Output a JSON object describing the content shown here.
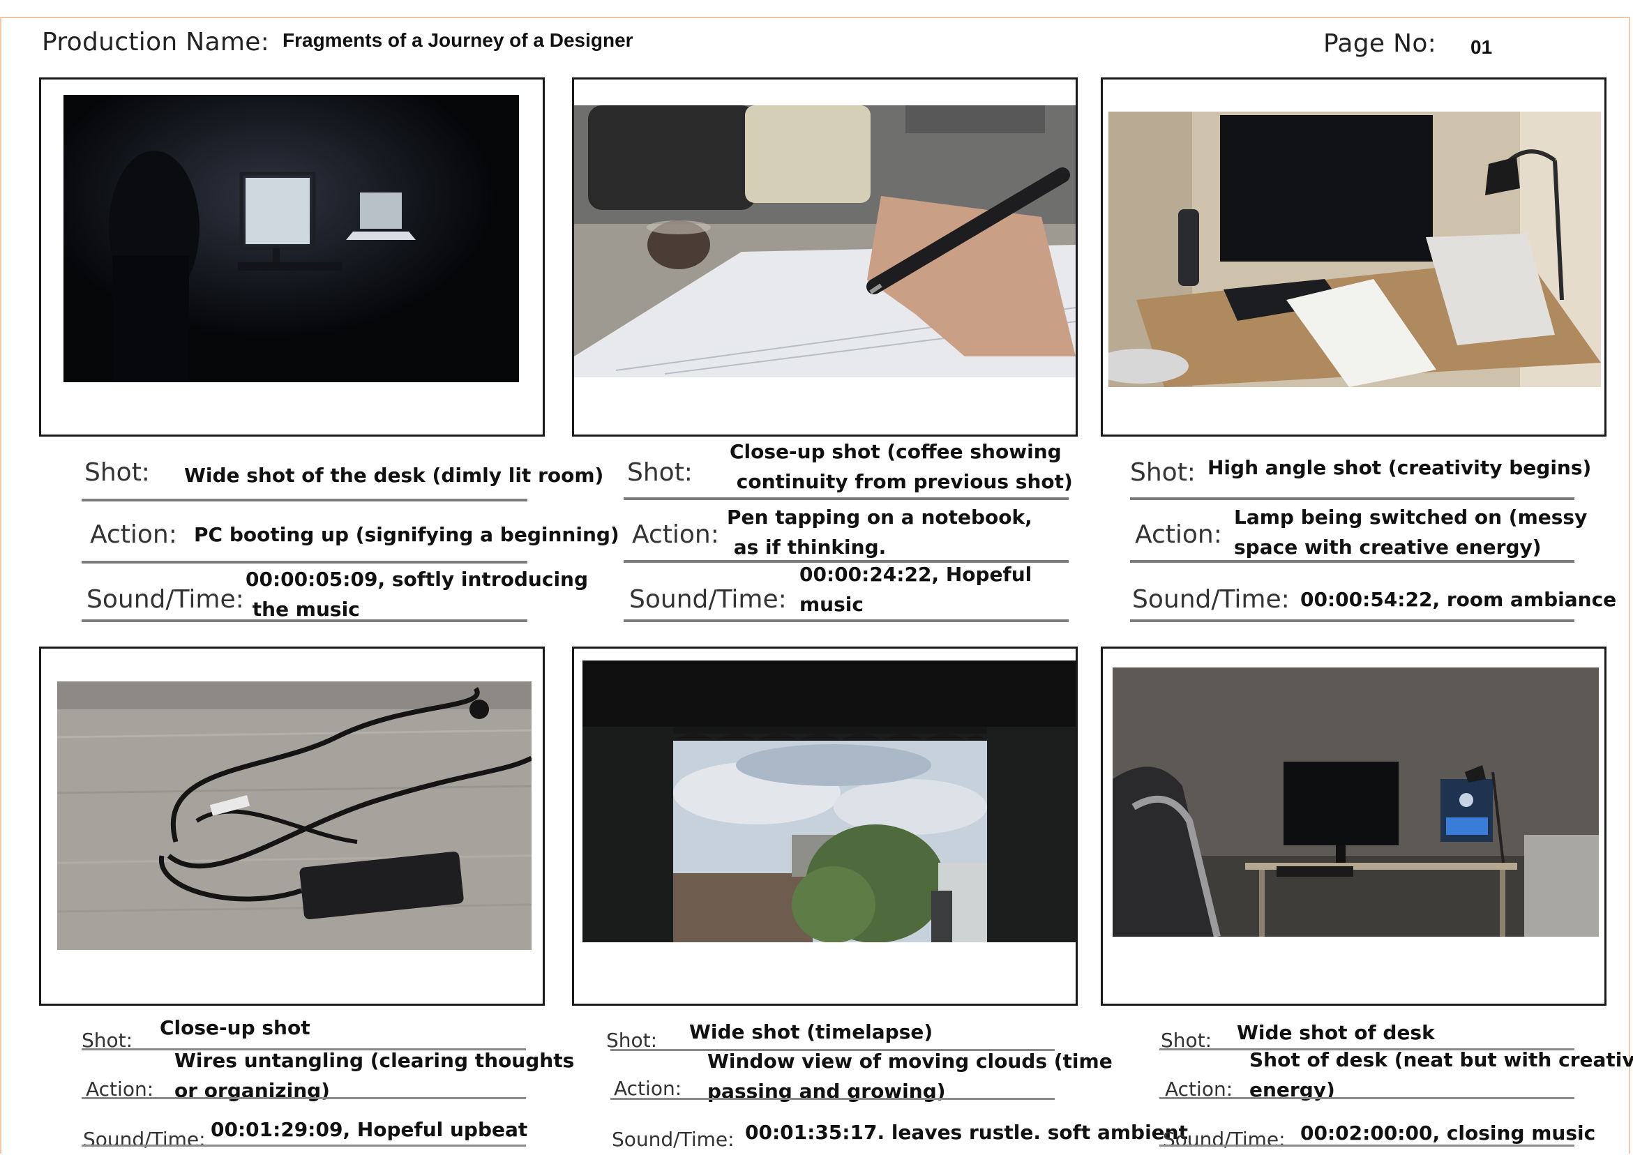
{
  "header": {
    "production_label": "Production Name:",
    "production_name": "Fragments of a Journey of a Designer",
    "page_label": "Page No:",
    "page_number": "01"
  },
  "labels": {
    "shot": "Shot:",
    "action": "Action:",
    "sound_time": "Sound/Time:"
  },
  "panels": [
    {
      "image": "dark room with glowing monitor and laptop at desk",
      "shot": "Wide shot of the desk (dimly lit room)",
      "action": "PC booting up (signifying a beginning)",
      "sound_time": "00:00:05:09, softly introducing\n the music"
    },
    {
      "image": "hand holding pen over lined notebook next to coffee cup",
      "shot": "Close-up shot (coffee showing\n continuity from previous shot)",
      "action": "Pen tapping on a notebook,\n as if thinking.",
      "sound_time": "00:00:24:22, Hopeful\nmusic"
    },
    {
      "image": "messy desk lit by lamp with monitor, keyboard and notebook",
      "shot": "High angle shot (creativity begins)",
      "action": "Lamp being switched on (messy\nspace with creative energy)",
      "sound_time": "00:00:54:22, room ambiance"
    },
    {
      "image": "tangled black charger cables on wooden table",
      "shot": "Close-up shot",
      "action": "Wires untangling (clearing thoughts\nor organizing)",
      "sound_time": "00:01:29:09, Hopeful upbeat"
    },
    {
      "image": "window view of cloudy sky, trees and fence",
      "shot": "Wide shot (timelapse)",
      "action": "Window view of moving clouds (time\npassing and growing)",
      "sound_time": "00:01:35:17. leaves rustle. soft ambient"
    },
    {
      "image": "tidy desk with monitor, lamp and laptop beside gaming chair",
      "shot": "Wide shot of desk",
      "action": "Shot of desk (neat but with creative\nenergy)",
      "sound_time": "00:02:00:00, closing music"
    }
  ]
}
